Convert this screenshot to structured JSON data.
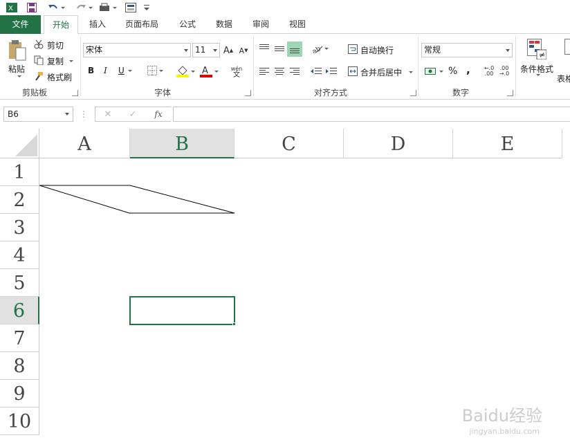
{
  "qat": {
    "icons": [
      "excel-logo-icon",
      "save-icon",
      "undo-icon",
      "redo-icon",
      "print-preview-icon",
      "form-icon",
      "customize-icon"
    ]
  },
  "tabs": [
    {
      "label": "文件",
      "active": false
    },
    {
      "label": "开始",
      "active": true
    },
    {
      "label": "插入",
      "active": false
    },
    {
      "label": "页面布局",
      "active": false
    },
    {
      "label": "公式",
      "active": false
    },
    {
      "label": "数据",
      "active": false
    },
    {
      "label": "审阅",
      "active": false
    },
    {
      "label": "视图",
      "active": false
    }
  ],
  "ribbon": {
    "clipboard": {
      "paste": "粘贴",
      "cut": "剪切",
      "copy": "复制",
      "format_painter": "格式刷",
      "label": "剪贴板"
    },
    "font": {
      "font_name": "宋体",
      "font_size": "11",
      "bold": "B",
      "italic": "I",
      "underline": "U",
      "wen": "wén",
      "wen_char": "文",
      "label": "字体"
    },
    "alignment": {
      "wrap_text": "自动换行",
      "merge_center": "合并后居中",
      "label": "对齐方式"
    },
    "number": {
      "format": "常规",
      "percent": "%",
      "comma": ",",
      "label": "数字"
    },
    "styles": {
      "conditional": "条件格式",
      "table": "表格"
    }
  },
  "formula_bar": {
    "name_box": "B6",
    "cancel": "✕",
    "enter": "✓",
    "fx": "fx",
    "value": ""
  },
  "grid": {
    "columns": [
      "A",
      "B",
      "C",
      "D",
      "E"
    ],
    "rows": [
      "1",
      "2",
      "3",
      "4",
      "5",
      "6",
      "7",
      "8",
      "9",
      "10"
    ],
    "selected_column": "B",
    "selected_row": "6",
    "active_cell": "B6"
  },
  "colors": {
    "accent": "#217346",
    "header_selected_bg": "#e1e1e1"
  },
  "watermark": {
    "brand": "Baidu经验",
    "url": "jingyan.baidu.com"
  }
}
